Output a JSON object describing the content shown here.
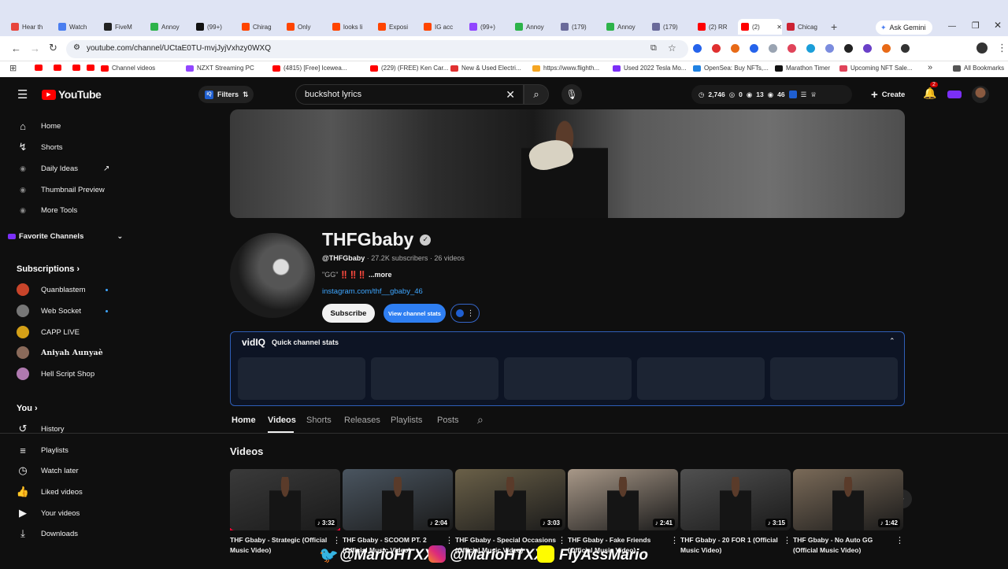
{
  "browser": {
    "tabs": [
      {
        "label": "Hear th",
        "color": "#e8453c"
      },
      {
        "label": "Watch",
        "color": "#4a7ef0"
      },
      {
        "label": "FiveM",
        "color": "#222222"
      },
      {
        "label": "Annoy",
        "color": "#2db34a"
      },
      {
        "label": "(99+)",
        "color": "#111111"
      },
      {
        "label": "Chirag",
        "color": "#ff4500"
      },
      {
        "label": "Only",
        "color": "#ff4500"
      },
      {
        "label": "looks li",
        "color": "#ff4500"
      },
      {
        "label": "Exposi",
        "color": "#ff4500"
      },
      {
        "label": "IG acc",
        "color": "#ff4500"
      },
      {
        "label": "(99+)",
        "color": "#9146ff"
      },
      {
        "label": "Annoy",
        "color": "#2db34a"
      },
      {
        "label": "(179)",
        "color": "#6a6a9a"
      },
      {
        "label": "Annoy",
        "color": "#2db34a"
      },
      {
        "label": "(179)",
        "color": "#6a6a9a"
      },
      {
        "label": "(2) RR",
        "color": "#ff0000"
      },
      {
        "label": "(2)",
        "color": "#ff0000"
      },
      {
        "label": "Chicag",
        "color": "#cc2233"
      }
    ],
    "ask_gemini": "Ask Gemini",
    "url": "youtube.com/channel/UCtaE0TU-mvjJyjVxhzy0WXQ",
    "bookmarks": [
      "Channel videos",
      "NZXT Streaming PC",
      "(4815) [Free] Icewea...",
      "(229) (FREE) Ken Car...",
      "New & Used Electri...",
      "https://www.flighth...",
      "Used 2022 Tesla Mo...",
      "OpenSea: Buy NFTs,...",
      "Marathon Timer",
      "Upcoming NFT Sale...",
      "All Bookmarks"
    ]
  },
  "yt": {
    "logo": "YouTube",
    "filters": "Filters",
    "search_value": "buckshot lyrics",
    "stats": {
      "views": "2,746",
      "a": "0",
      "b": "13",
      "c": "46"
    },
    "create": "Create",
    "notif_count": "2",
    "sidebar": {
      "main": [
        "Home",
        "Shorts",
        "Daily Ideas",
        "Thumbnail Preview",
        "More Tools"
      ],
      "favorite": "Favorite Channels",
      "subs_head": "Subscriptions",
      "subs": [
        "Quanblastem",
        "Web Socket",
        "CAPP LIVE",
        "Aniyah Aunyaè",
        "Hell Script Shop"
      ],
      "you_head": "You",
      "you": [
        "History",
        "Playlists",
        "Watch later",
        "Liked videos",
        "Your videos",
        "Downloads"
      ]
    },
    "channel": {
      "name": "THFGbaby",
      "handle": "@THFGbaby",
      "subscribers": "27.2K subscribers",
      "videos": "26 videos",
      "desc": "\"GG\"",
      "desc_marks": "‼️‼️‼️",
      "more": "...more",
      "link": "instagram.com/thf__gbaby_46",
      "subscribe": "Subscribe",
      "view_stats": "View channel stats"
    },
    "vidiq": {
      "logo": "vidIQ",
      "title": "Quick channel stats"
    },
    "tabs": [
      "Home",
      "Videos",
      "Shorts",
      "Releases",
      "Playlists",
      "Posts"
    ],
    "section": "Videos",
    "videos": [
      {
        "title": "THF Gbaby - Strategic (Official Music Video)",
        "duration": "3:32",
        "bg": "#3a3a3a"
      },
      {
        "title": "THF Gbaby - SCOOM PT. 2 (Official Music Video)",
        "duration": "2:04",
        "bg": "#4a5560"
      },
      {
        "title": "THF Gbaby - Special Occasions (Official Music Video)",
        "duration": "3:03",
        "bg": "#6a6048"
      },
      {
        "title": "THF Gbaby - Fake Friends (Official Music Video)",
        "duration": "2:41",
        "bg": "#a89888"
      },
      {
        "title": "THF Gbaby - 20 FOR 1 (Official Music Video)",
        "duration": "3:15",
        "bg": "#505050"
      },
      {
        "title": "THF Gbaby - No Auto GG (Official Music Video)",
        "duration": "1:42",
        "bg": "#7a6a58"
      }
    ]
  },
  "overlay": {
    "twitter": "@MarioHTXX",
    "instagram": "@MarioHTXX",
    "snapchat": "FlyAssMario"
  }
}
